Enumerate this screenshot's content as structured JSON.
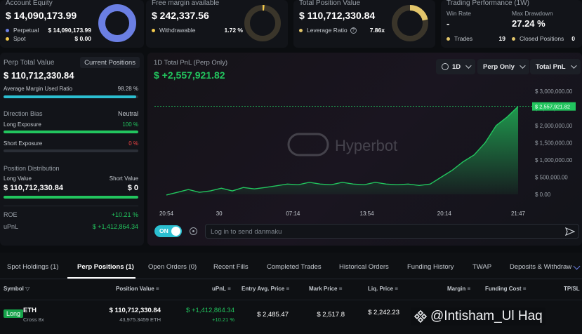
{
  "account_equity": {
    "title": "Account Equity",
    "value": "$ 14,090,173.99",
    "rows": [
      {
        "label": "Perpetual",
        "value": "$ 14,090,173.99",
        "color": "#6b7fe3"
      },
      {
        "label": "Spot",
        "value": "$ 0.00",
        "color": "#f2c94c"
      }
    ]
  },
  "free_margin": {
    "title": "Free margin available",
    "value": "$ 242,337.56",
    "row_label": "Withdrawable",
    "row_value": "1.72 %",
    "color": "#f2c94c"
  },
  "total_position": {
    "title": "Total Position Value",
    "value": "$ 110,712,330.84",
    "row_label": "Leverage Ratio",
    "row_value": "7.86x",
    "color": "#e2c56a"
  },
  "trading_performance": {
    "title": "Trading Performance (1W)",
    "win_rate_label": "Win Rate",
    "win_rate_value": "-",
    "max_dd_label": "Max Drawdown",
    "max_dd_value": "27.24 %",
    "trades_label": "Trades",
    "trades_value": "19",
    "closed_label": "Closed Positions",
    "closed_value": "0"
  },
  "left_panel": {
    "perp_total_label": "Perp Total Value",
    "current_positions_label": "Current Positions",
    "perp_total_value": "$ 110,712,330.84",
    "avg_margin_label": "Average Margin Used Ratio",
    "avg_margin_value": "98.28 %",
    "avg_margin_fraction": 0.9828,
    "direction_bias_label": "Direction Bias",
    "direction_bias_value": "Neutral",
    "long_exposure_label": "Long Exposure",
    "long_exposure_value": "100 %",
    "short_exposure_label": "Short Exposure",
    "short_exposure_value": "0 %",
    "position_dist_label": "Position Distribution",
    "long_value_label": "Long Value",
    "short_value_label": "Short Value",
    "long_value": "$ 110,712,330.84",
    "short_value": "$ 0",
    "roe_label": "ROE",
    "roe_value": "+10.21 %",
    "upnl_label": "uPnL",
    "upnl_value": "$ +1,412,864.34"
  },
  "chart_panel": {
    "title": "1D Total PnL (Perp Only)",
    "value": "$ +2,557,921.82",
    "timeframe": "1D",
    "scope": "Perp Only",
    "metric": "Total PnL",
    "watermark": "Hyperbot",
    "toggle_label": "ON",
    "danmaku_placeholder": "Log in to send danmaku"
  },
  "chart_data": {
    "type": "area",
    "title": "1D Total PnL (Perp Only)",
    "x_ticks": [
      "20:54",
      "30",
      "07:14",
      "13:54",
      "20:14",
      "21:47"
    ],
    "y_ticks": [
      "$ 0.00",
      "$ 500,000.00",
      "$ 1,000,000.00",
      "$ 1,500,000.00",
      "$ 2,000,000.00",
      "$ 2,500,000.00",
      "$ 3,000,000.00"
    ],
    "ylim": [
      0,
      3000000
    ],
    "last_value_label": "$ 2,557,921.82",
    "series": [
      {
        "values": [
          -20000,
          60000,
          140000,
          60000,
          100000,
          180000,
          100000,
          200000,
          160000,
          200000,
          250000,
          300000,
          280000,
          350000,
          300000,
          280000,
          350000,
          300000,
          280000,
          350000,
          300000,
          280000,
          300000,
          260000,
          300000,
          500000,
          700000,
          950000,
          1150000,
          1500000,
          2000000,
          2250000,
          2557921
        ]
      }
    ],
    "color": "#22c55e"
  },
  "tabs": [
    "Spot Holdings (1)",
    "Perp Positions (1)",
    "Open Orders (0)",
    "Recent Fills",
    "Completed Trades",
    "Historical Orders",
    "Funding History",
    "TWAP",
    "Deposits & Withdraw"
  ],
  "table": {
    "headers": [
      "Symbol",
      "Position Value",
      "uPnL",
      "Entry Avg. Price",
      "Mark Price",
      "Liq. Price",
      "Margin",
      "Funding Cost",
      "TP/SL"
    ],
    "row": {
      "side": "Long",
      "symbol": "ETH",
      "leverage": "Cross 8x",
      "position_value": "$ 110,712,330.84",
      "position_size": "43,975.3459 ETH",
      "upnl": "$ +1,412,864.34",
      "upnl_pct": "+10.21 %",
      "entry_price": "$ 2,485.47",
      "mark_price": "$ 2,517.8",
      "liq_price": "$ 2,242.23"
    }
  },
  "watermark_text": "@Intisham_Ul Haq"
}
